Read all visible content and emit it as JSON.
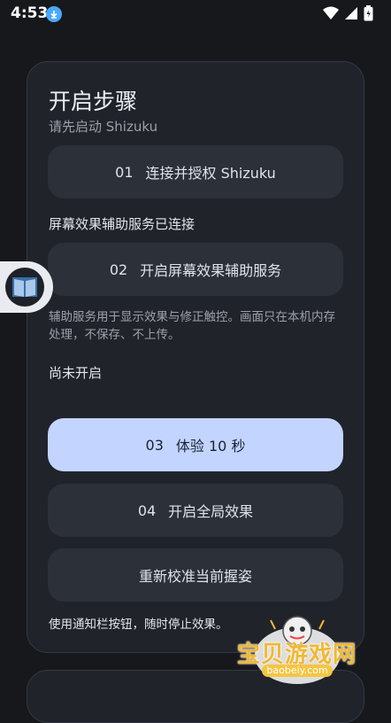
{
  "status_bar": {
    "time": "4:53",
    "icons": [
      "download-icon",
      "wifi-icon",
      "signal-icon",
      "battery-icon"
    ]
  },
  "card": {
    "title": "开启步骤",
    "subtitle": "请先启动 Shizuku",
    "step1": {
      "num": "01",
      "label": "连接并授权 Shizuku"
    },
    "status1": "屏幕效果辅助服务已连接",
    "step2": {
      "num": "02",
      "label": "开启屏幕效果辅助服务"
    },
    "note2": "辅助服务用于显示效果与修正触控。画面只在本机内存处理，不保存、不上传。",
    "status3": "尚未开启",
    "step3": {
      "num": "03",
      "label": "体验 10 秒"
    },
    "step4": {
      "num": "04",
      "label": "开启全局效果"
    },
    "recalibrate": "重新校准当前握姿",
    "footer_note": "使用通知栏按钮，随时停止效果。"
  },
  "watermark": {
    "text": "宝贝游戏网",
    "url": "baobeiy.com"
  },
  "colors": {
    "background": "#16181c",
    "card": "#20232a",
    "button": "#2c3038",
    "primary": "#c3d4ff"
  }
}
